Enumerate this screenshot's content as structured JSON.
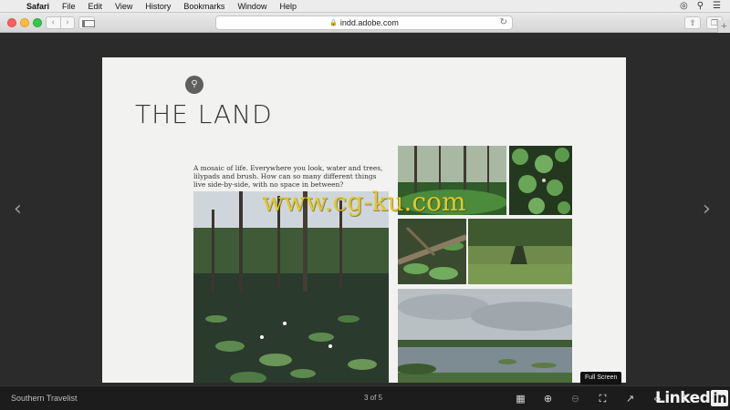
{
  "menubar": {
    "items": [
      "Safari",
      "File",
      "Edit",
      "View",
      "History",
      "Bookmarks",
      "Window",
      "Help"
    ]
  },
  "browser": {
    "url": "indd.adobe.com"
  },
  "page": {
    "title": "THE LAND",
    "blurb": "A mosaic of life. Everywhere you look, water and trees, lilypads and brush. How can so many different things live side-by-side, with no space in between?"
  },
  "watermark": "www.cg-ku.com",
  "tooltip": "Full Screen",
  "bottombar": {
    "document_title": "Southern Travelist",
    "page_count": "3 of 5",
    "brand": "Linked",
    "brand_in": "in"
  },
  "icons": {
    "nav_prev": "chevron-left-icon",
    "nav_next": "chevron-right-icon",
    "grid": "grid-icon",
    "zoom_in": "zoom-in-icon",
    "zoom_out": "zoom-out-icon",
    "fullscreen": "fullscreen-icon",
    "share": "share-icon",
    "embed": "embed-icon",
    "sound": "sound-icon"
  },
  "colors": {
    "viewer_bg": "#2b2b2b",
    "page_bg": "#f2f2f1",
    "bottombar_bg": "#1c1c1c",
    "watermark": "#e2c82a"
  }
}
